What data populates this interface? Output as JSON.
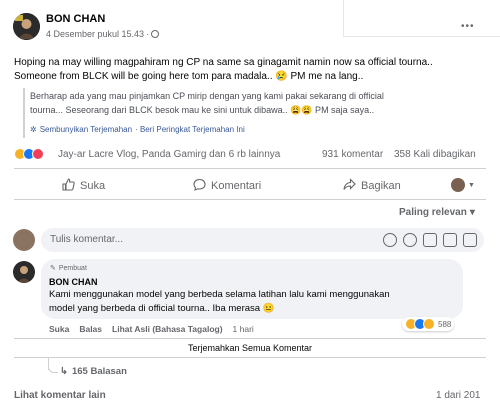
{
  "post": {
    "author": "BON CHAN",
    "date": "4 Desember pukul 15.43",
    "date_sep": "·",
    "more": "•••",
    "text_line1": "Hoping na may willing magpahiram ng CP na same sa ginagamit namin now sa official tourna..",
    "text_line2": "Someone from BLCK will be going here tom para madala.. 😢 PM me na lang..",
    "translation_line1": "Berharap ada yang mau pinjamkan CP mirip dengan yang kami pakai sekarang di official",
    "translation_line2": "tourna... Seseorang dari BLCK besok mau ke sini untuk dibawa.. 😩😩 PM saja saya..",
    "hide_translation": "Sembunyikan Terjemahan",
    "rate_translation": "· Beri Peringkat Terjemahan Ini",
    "reactions_text": "Jay-ar Lacre Vlog, Panda Gamirg dan 6 rb lainnya",
    "comments_count": "931 komentar",
    "shares_count": "358 Kali dibagikan"
  },
  "actions": {
    "like": "Suka",
    "comment": "Komentari",
    "share": "Bagikan"
  },
  "sort": {
    "label": "Paling relevan",
    "arrow": "▾"
  },
  "composer": {
    "placeholder": "Tulis komentar..."
  },
  "comment": {
    "badge": "Pembuat",
    "author": "BON CHAN",
    "text_line1": "Kami menggunakan model yang berbeda selama latihan lalu kami menggunakan",
    "text_line2": "model yang berbeda di official tourna.. Iba merasa 😐",
    "reaction_count": "588",
    "like": "Suka",
    "reply": "Balas",
    "see_original": "Lihat Asli (Bahasa Tagalog)",
    "age": "1 hari"
  },
  "translate_all": "Terjemahkan Semua Komentar",
  "replies": "165 Balasan",
  "more_comments": "Lihat komentar lain",
  "pagination": "1 dari 201",
  "colors": {
    "link_blue": "#385898",
    "like_blue": "#1877f2",
    "love_red": "#f33e58",
    "haha_yellow": "#f7b125",
    "muted": "#65676b",
    "bubble": "#f0f2f5"
  }
}
